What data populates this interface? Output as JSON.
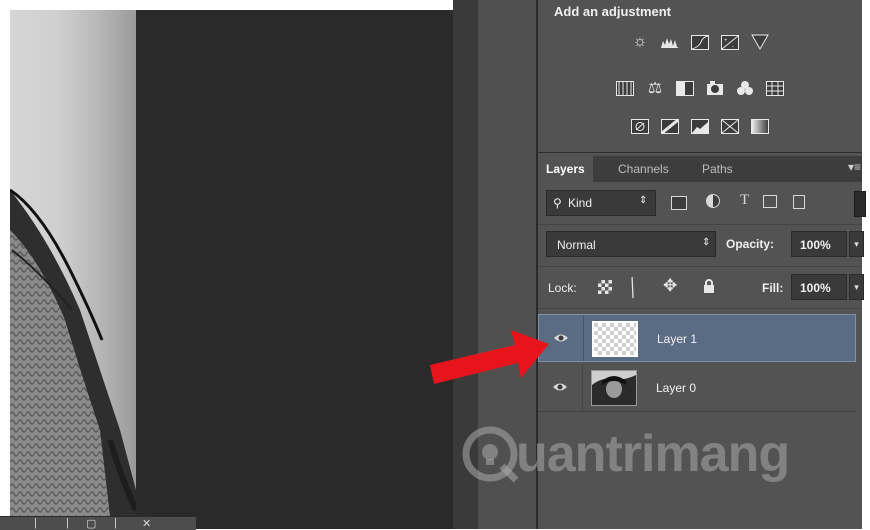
{
  "adjustments": {
    "title": "Add an adjustment",
    "row1": [
      "brightness-contrast-icon",
      "levels-icon",
      "curves-icon",
      "exposure-icon",
      "gradient-triangle-icon"
    ],
    "row2": [
      "vibrance-icon",
      "color-balance-icon",
      "black-white-icon",
      "photo-filter-icon",
      "channel-mixer-icon",
      "color-lookup-icon"
    ],
    "row3": [
      "invert-icon",
      "posterize-icon",
      "threshold-icon",
      "selective-color-icon",
      "gradient-map-icon"
    ]
  },
  "layers_panel": {
    "tabs": [
      "Layers",
      "Channels",
      "Paths"
    ],
    "active_tab": "Layers",
    "filter": {
      "kind_label": "Kind"
    },
    "blend_mode": "Normal",
    "opacity_label": "Opacity:",
    "opacity_value": "100%",
    "lock_label": "Lock:",
    "fill_label": "Fill:",
    "fill_value": "100%",
    "layers": [
      {
        "name": "Layer 1",
        "selected": true,
        "visible": true
      },
      {
        "name": "Layer 0",
        "selected": false,
        "visible": true
      }
    ]
  },
  "watermark": {
    "text": "uantrimang"
  },
  "colors": {
    "selected_row": "#5a6b84",
    "panel": "#535353",
    "arrow": "#e8141c"
  }
}
